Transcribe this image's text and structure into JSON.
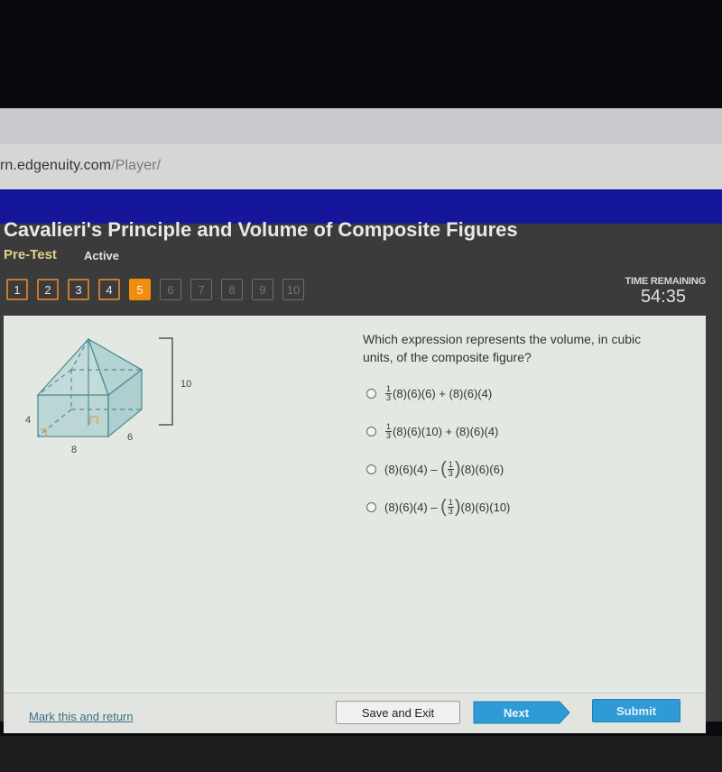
{
  "browser": {
    "url_prefix": "rn.edgenuity.com",
    "url_suffix": "/Player/"
  },
  "header": {
    "lesson_title": "Cavalieri's Principle and Volume of Composite Figures",
    "activity_type": "Pre-Test",
    "status": "Active"
  },
  "question_nav": {
    "items": [
      {
        "label": "1",
        "state": "answered"
      },
      {
        "label": "2",
        "state": "answered"
      },
      {
        "label": "3",
        "state": "answered"
      },
      {
        "label": "4",
        "state": "answered"
      },
      {
        "label": "5",
        "state": "current"
      },
      {
        "label": "6",
        "state": "locked"
      },
      {
        "label": "7",
        "state": "locked"
      },
      {
        "label": "8",
        "state": "locked"
      },
      {
        "label": "9",
        "state": "locked"
      },
      {
        "label": "10",
        "state": "locked"
      }
    ]
  },
  "timer": {
    "label": "TIME REMAINING",
    "value": "54:35"
  },
  "figure": {
    "label_height_total": "10",
    "label_prism_height": "4",
    "label_length": "8",
    "label_width": "6"
  },
  "question": {
    "text": "Which expression represents the volume, in cubic units, of the composite figure?",
    "options": [
      {
        "frac_num": "1",
        "frac_den": "3",
        "text": "(8)(6)(6) + (8)(6)(4)"
      },
      {
        "frac_num": "1",
        "frac_den": "3",
        "text": "(8)(6)(10) + (8)(6)(4)"
      },
      {
        "prefix": "(8)(6)(4) – ",
        "frac_num": "1",
        "frac_den": "3",
        "text": "(8)(6)(6)"
      },
      {
        "prefix": "(8)(6)(4) – ",
        "frac_num": "1",
        "frac_den": "3",
        "text": "(8)(6)(10)"
      }
    ]
  },
  "footer": {
    "mark_link": "Mark this and return",
    "save_label": "Save and Exit",
    "next_label": "Next",
    "submit_label": "Submit"
  },
  "colors": {
    "accent_orange": "#f08c10",
    "button_blue": "#2f9bd6",
    "header_blue": "#15169a"
  }
}
